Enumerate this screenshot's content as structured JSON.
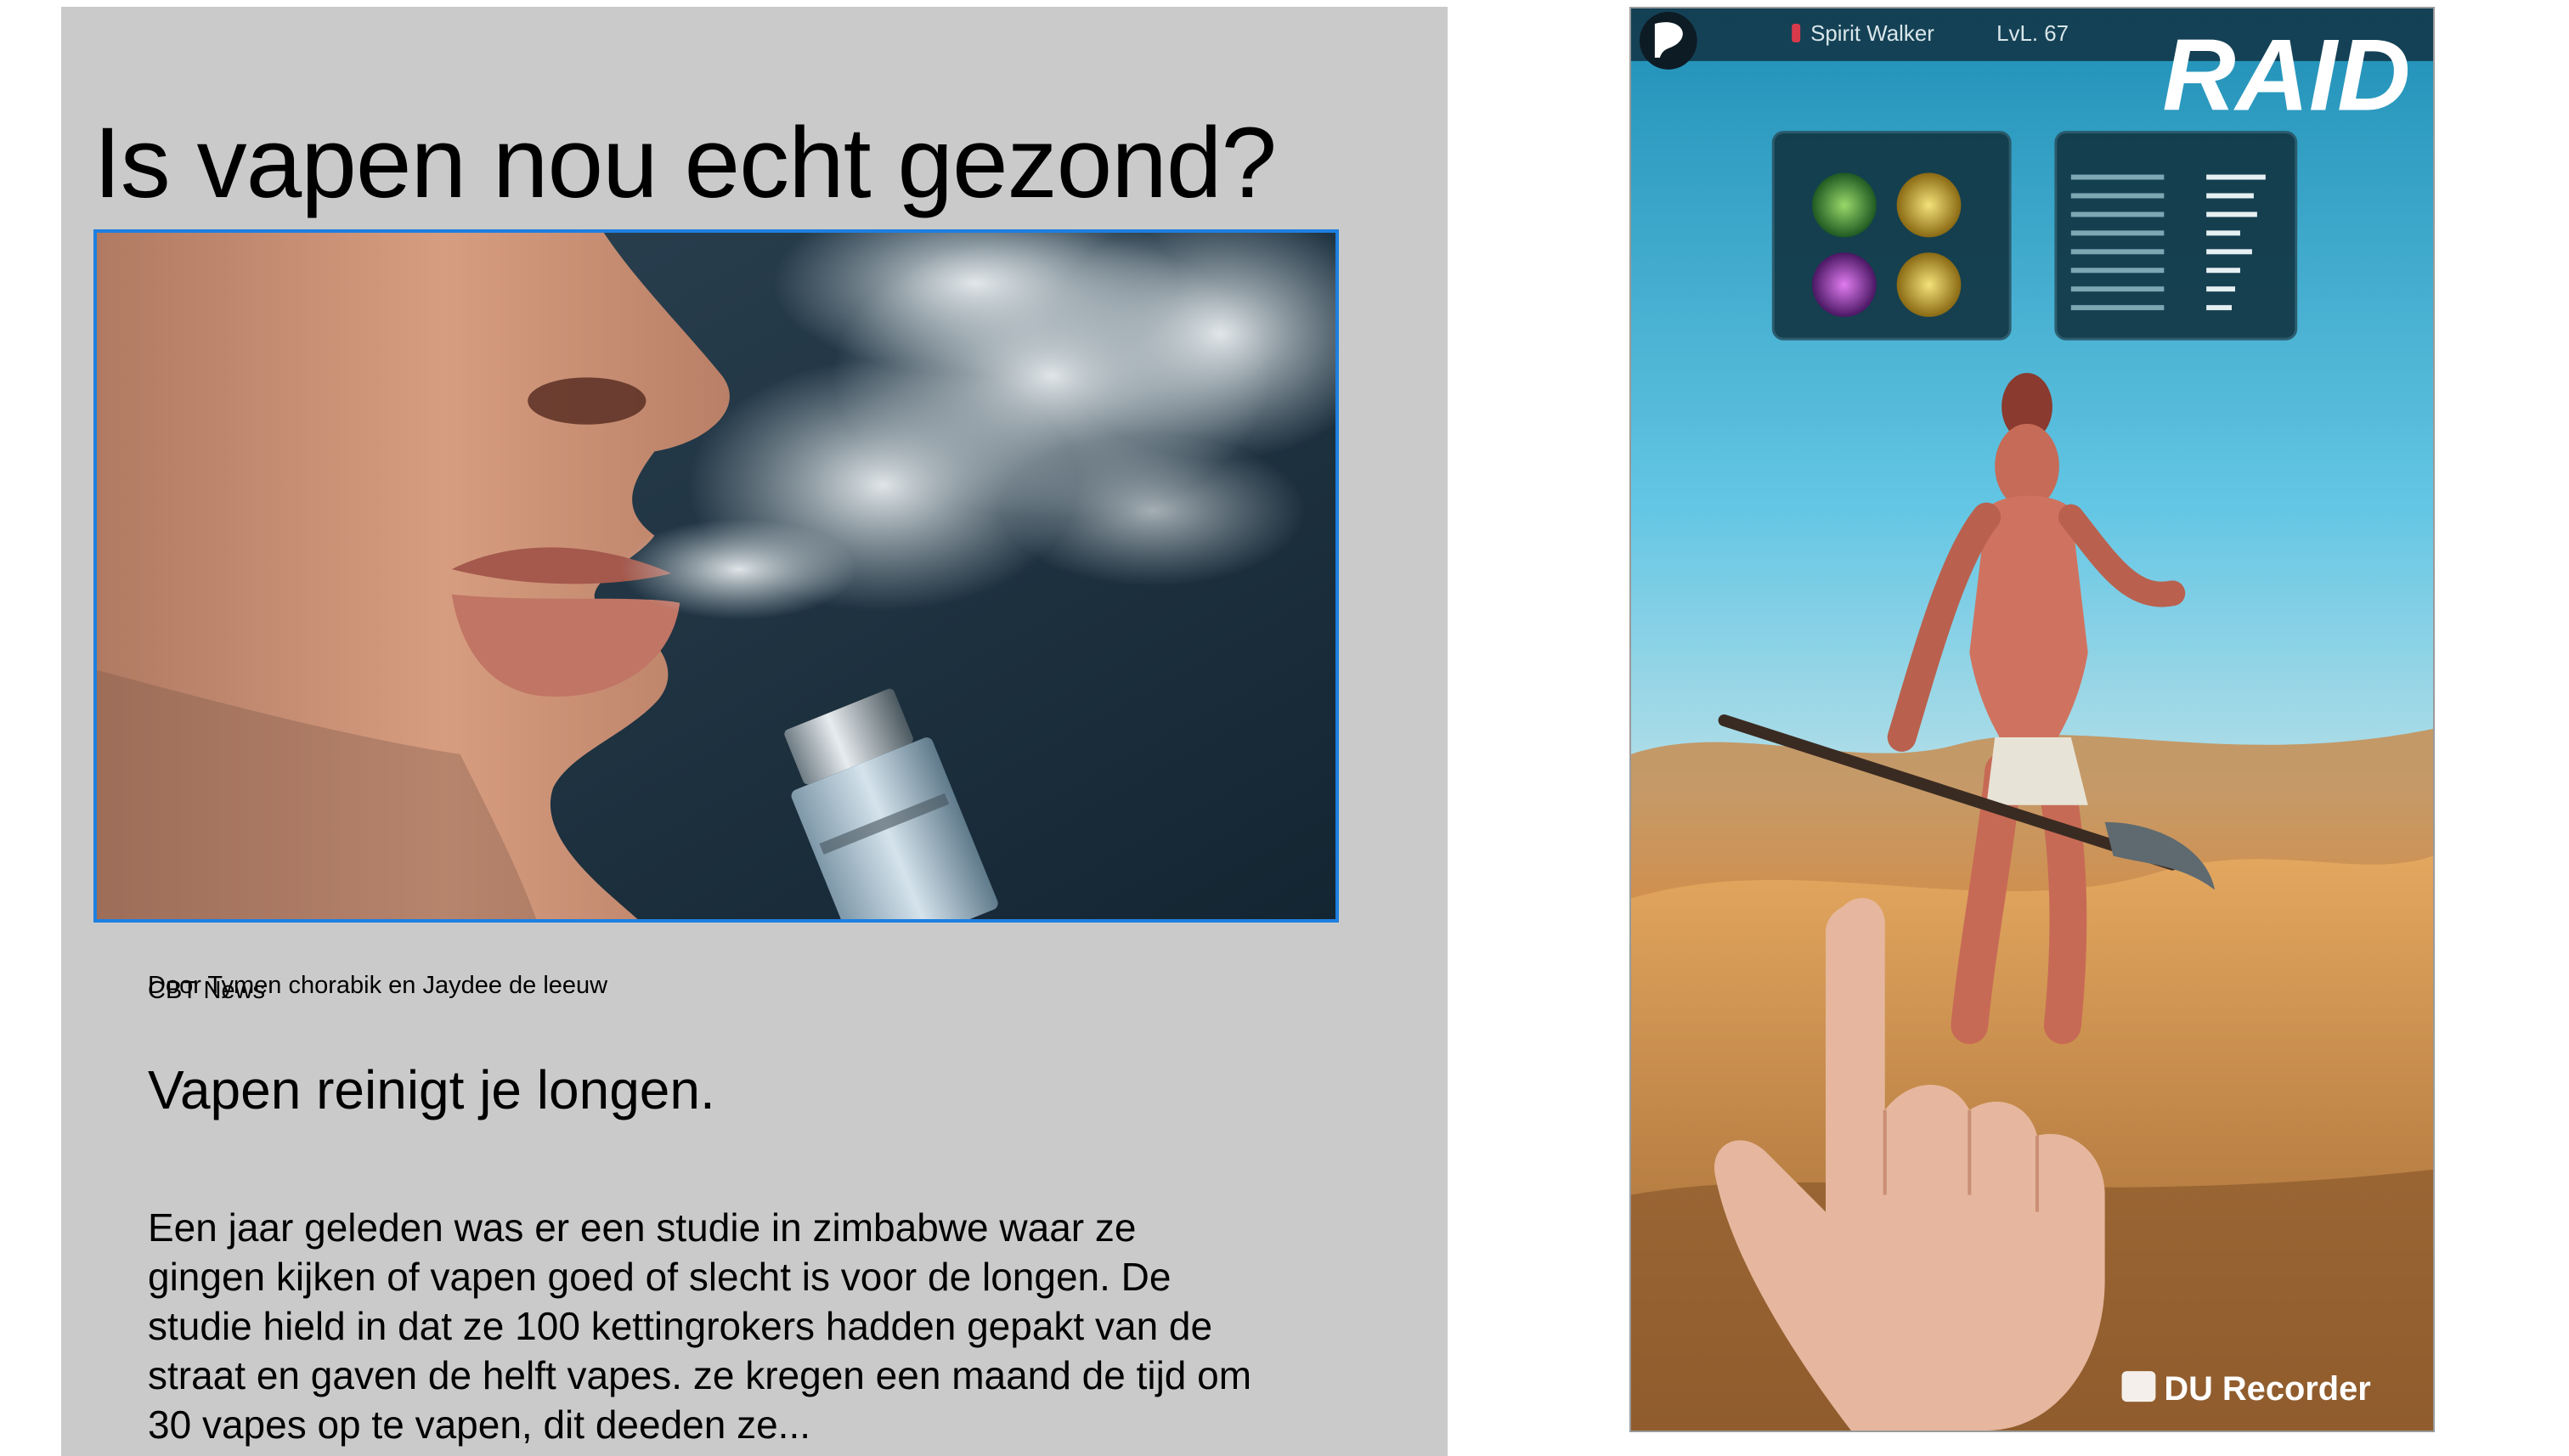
{
  "article": {
    "title": "Is vapen nou echt gezond?",
    "byline": "Door Tymen chorabik en Jaydee de leeuw",
    "source": "CBT News",
    "section_heading": "Vapen reinigt je longen.",
    "body": "Een jaar geleden was er een studie in zimbabwe waar ze gingen kijken of vapen goed of slecht is voor de longen. De studie hield in dat ze 100 kettingrokers hadden gepakt van de straat en gaven de helft vapes. ze kregen een maand de tijd om 30 vapes op te vapen, dit deeden ze..."
  },
  "game": {
    "champion_name": "Spirit Walker",
    "champion_level": "LvL. 67",
    "brand": "RAID",
    "recorder_watermark": "DU Recorder"
  },
  "colors": {
    "article_background": "#cacaca",
    "image_border": "#1e7fe0"
  }
}
